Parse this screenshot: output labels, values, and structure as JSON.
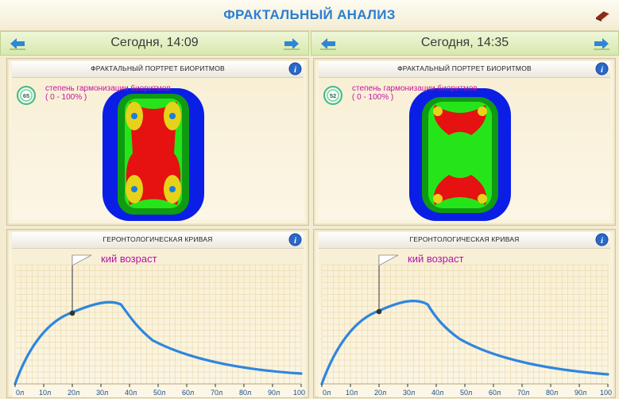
{
  "app": {
    "title": "ФРАКТАЛЬНЫЙ АНАЛИЗ",
    "accent": "#2a7fd1",
    "icons": {
      "top_right": "book-icon",
      "nav_prev": "arrow-left-icon",
      "nav_next": "arrow-right-icon",
      "info": "info-icon"
    }
  },
  "columns": [
    {
      "date": "Сегодня, 14:09",
      "fractal": {
        "title": "ФРАКТАЛЬНЫЙ ПОРТРЕТ БИОРИТМОВ",
        "harmonization_value": "65",
        "harmonization_label": "степень гармонизации биоритмов",
        "harmonization_range": "( 0 - 100% )"
      },
      "curve": {
        "title": "ГЕРОНТОЛОГИЧЕСКАЯ КРИВАЯ",
        "flag_label": "кий возраст",
        "marker_age": 20
      }
    },
    {
      "date": "Сегодня, 14:35",
      "fractal": {
        "title": "ФРАКТАЛЬНЫЙ ПОРТРЕТ БИОРИТМОВ",
        "harmonization_value": "52",
        "harmonization_label": "степень гармонизации биоритмов",
        "harmonization_range": "( 0 - 100% )"
      },
      "curve": {
        "title": "ГЕРОНТОЛОГИЧЕСКАЯ КРИВАЯ",
        "flag_label": "кий возраст",
        "marker_age": 20
      }
    }
  ],
  "axis": {
    "ticks": [
      "0л",
      "10л",
      "20л",
      "30л",
      "40л",
      "50л",
      "60л",
      "70л",
      "80л",
      "90л",
      "100л"
    ]
  },
  "colors": {
    "curve": "#2e86de",
    "fractal_outer": "#0a1ee6",
    "fractal_mid": "#0f9a12",
    "fractal_light": "#25e51a",
    "fractal_core": "#e61111",
    "fractal_accent": "#e6d21a",
    "label_magenta": "#c0169b"
  }
}
